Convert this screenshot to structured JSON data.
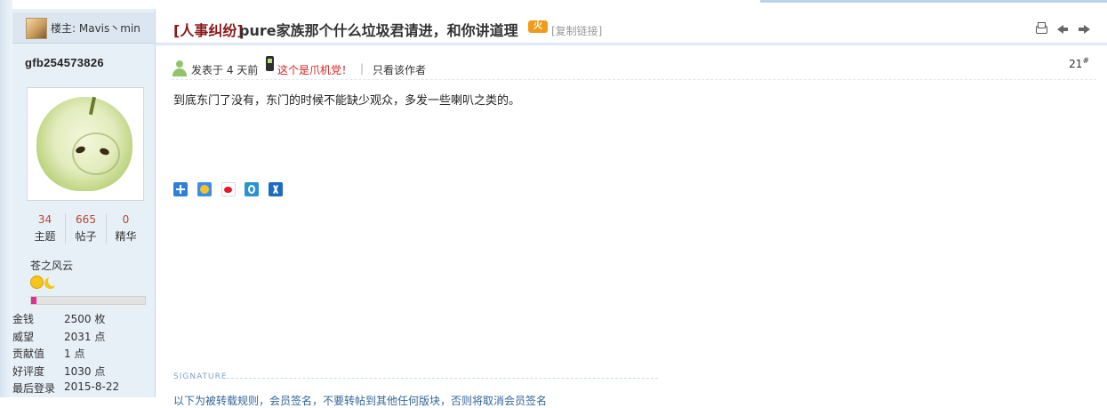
{
  "thread": {
    "tag": "[人事纠纷]",
    "title": "pure家族那个什么垃圾君请进，和你讲道理",
    "hot_badge": "火",
    "copy_link": "[复制链接]"
  },
  "owner": {
    "label": "楼主: Mavis丶min"
  },
  "profile": {
    "username": "gfb254573826",
    "stats": [
      {
        "value": "34",
        "label": "主题"
      },
      {
        "value": "665",
        "label": "帖子"
      },
      {
        "value": "0",
        "label": "精华"
      }
    ],
    "group": "苍之风云",
    "level_progress": 0.05,
    "info": [
      {
        "key": "金钱",
        "value": "2500 枚"
      },
      {
        "key": "威望",
        "value": "2031 点"
      },
      {
        "key": "贡献值",
        "value": "1 点"
      },
      {
        "key": "好评度",
        "value": "1030 点"
      },
      {
        "key": "最后登录",
        "value": "2015-8-22"
      }
    ]
  },
  "post": {
    "posted": "发表于 4 天前",
    "device": "这个是爪机党！",
    "separator": "|",
    "author_only": "只看该作者",
    "floor": "21",
    "floor_mark": "#",
    "content": "到底东门了没有，东门的时候不能缺少观众，多发一些喇叭之类的。",
    "signature_label": "SIGNATURE",
    "signature_text": "以下为被转载规则，会员签名，不要转帖到其他任何版块，否则将取消会员签名"
  },
  "colors": {
    "tag": "#8a1818",
    "stat_number": "#b5482f",
    "device_label": "#d42020",
    "sidebar_bg": "#e7eff7",
    "progress_fill": "#e0308a"
  },
  "icons": [
    "print-icon",
    "prev-arrow-icon",
    "next-arrow-icon",
    "user-online-icon",
    "phone-icon",
    "share-plus-icon",
    "qzone-icon",
    "weibo-icon",
    "pengyou-icon",
    "renren-icon",
    "smile-icon",
    "moon-icon"
  ]
}
